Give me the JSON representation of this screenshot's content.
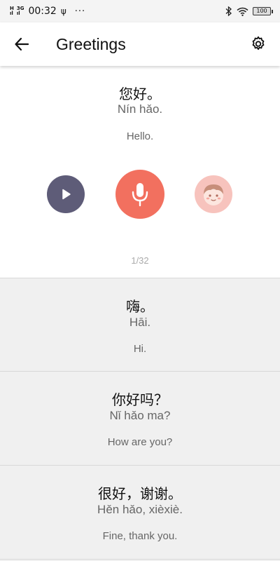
{
  "status_bar": {
    "net1": "H",
    "net1_sub": "ıl",
    "net2": "3G",
    "net2_sub": "ıl",
    "time": "00:32",
    "usb": "ψ",
    "dots": "···",
    "battery": "100"
  },
  "header": {
    "title": "Greetings",
    "back_icon": "arrow-left-icon",
    "settings_icon": "gear-icon"
  },
  "current": {
    "chinese": "您好。",
    "pinyin": "Nín hǎo.",
    "english": "Hello.",
    "counter": "1/32"
  },
  "colors": {
    "play": "#5e5c78",
    "mic": "#f2705f",
    "avatar": "#f7c3bd",
    "list_bg": "#f0f0f0"
  },
  "phrases": [
    {
      "chinese": "嗨。",
      "pinyin": "Hāi.",
      "english": "Hi."
    },
    {
      "chinese": "你好吗？",
      "pinyin": "Nǐ hǎo ma?",
      "english": "How are you?"
    },
    {
      "chinese": "很好，谢谢。",
      "pinyin": "Hěn hǎo, xièxiè.",
      "english": "Fine, thank you."
    }
  ]
}
